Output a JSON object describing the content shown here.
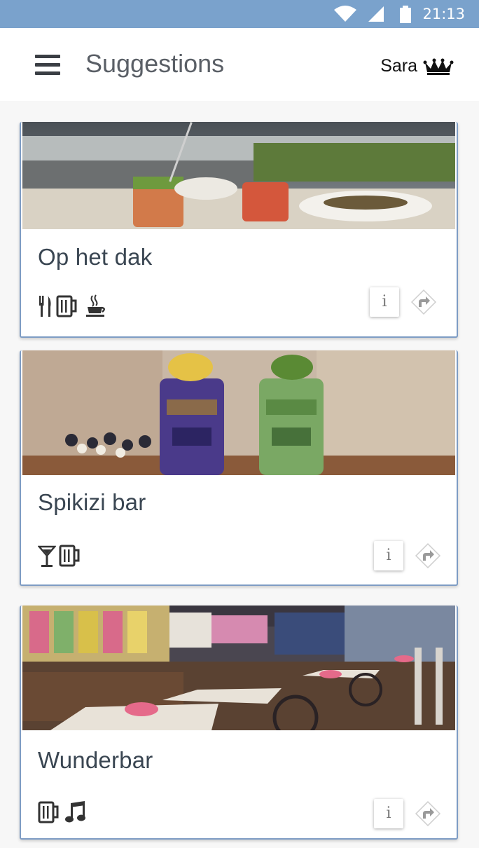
{
  "status": {
    "time": "21:13"
  },
  "appbar": {
    "title": "Suggestions",
    "user_name": "Sara"
  },
  "places": [
    {
      "name": "Op het dak",
      "features": [
        "fork-knife-icon",
        "beer-mug-icon",
        "coffee-cup-icon"
      ],
      "info_label": "i"
    },
    {
      "name": "Spikizi bar",
      "features": [
        "cocktail-glass-icon",
        "beer-mug-icon"
      ],
      "info_label": "i"
    },
    {
      "name": "Wunderbar",
      "features": [
        "beer-mug-icon",
        "music-note-icon"
      ],
      "info_label": "i"
    }
  ]
}
